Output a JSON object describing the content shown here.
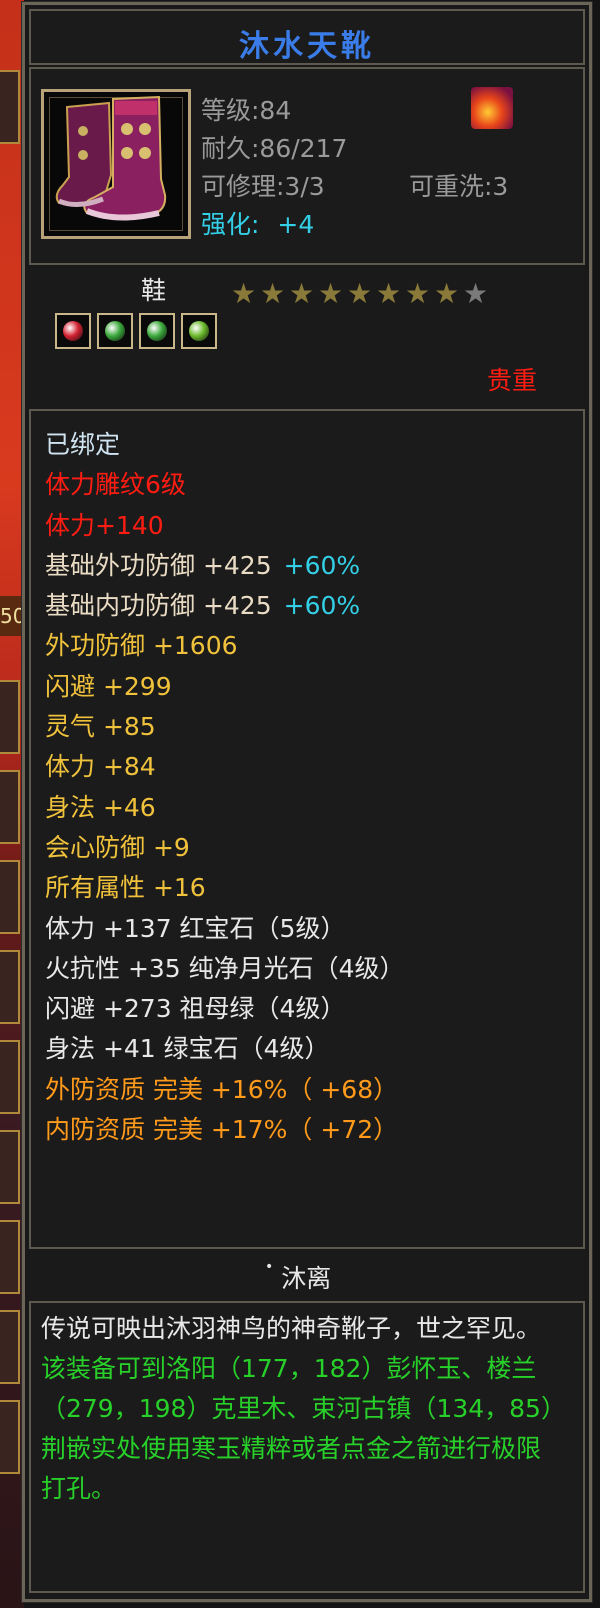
{
  "item": {
    "name": "沐水天靴",
    "level_label": "等级:84",
    "durability_label": "耐久:86/217",
    "repair_label": "可修理:3/3",
    "rewash_label": "可重洗:3",
    "enhance_label": "强化:",
    "enhance_value": "+4",
    "type": "鞋",
    "stars_total": 9,
    "stars_filled": 8,
    "rarity": "贵重",
    "gem_sockets": [
      {
        "color": "#d42030"
      },
      {
        "color": "#3aa83a"
      },
      {
        "color": "#3aa83a"
      },
      {
        "color": "#6ab82a"
      }
    ]
  },
  "stats": [
    {
      "text": "已绑定",
      "extra": "",
      "color": "light"
    },
    {
      "text": "体力雕纹6级",
      "extra": "",
      "color": "red"
    },
    {
      "text": "体力+140",
      "extra": "",
      "color": "red"
    },
    {
      "text": "基础外功防御 +425",
      "extra": "+60%",
      "color": "beige"
    },
    {
      "text": "基础内功防御 +425",
      "extra": "+60%",
      "color": "beige"
    },
    {
      "text": "外功防御 +1606",
      "extra": "",
      "color": "gold"
    },
    {
      "text": "闪避 +299",
      "extra": "",
      "color": "gold"
    },
    {
      "text": "灵气 +85",
      "extra": "",
      "color": "gold"
    },
    {
      "text": "体力 +84",
      "extra": "",
      "color": "gold"
    },
    {
      "text": "身法 +46",
      "extra": "",
      "color": "gold"
    },
    {
      "text": "会心防御 +9",
      "extra": "",
      "color": "gold"
    },
    {
      "text": "所有属性 +16",
      "extra": "",
      "color": "gold"
    },
    {
      "text": "体力 +137 红宝石（5级）",
      "extra": "",
      "color": "white"
    },
    {
      "text": "火抗性 +35 纯净月光石（4级）",
      "extra": "",
      "color": "white"
    },
    {
      "text": "闪避 +273 祖母绿（4级）",
      "extra": "",
      "color": "white"
    },
    {
      "text": "身法 +41 绿宝石（4级）",
      "extra": "",
      "color": "white"
    },
    {
      "text": "外防资质   完美 +16%（ +68）",
      "extra": "",
      "color": "orange"
    },
    {
      "text": "内防资质   完美 +17%（ +72）",
      "extra": "",
      "color": "orange"
    }
  ],
  "set_name": "沐离",
  "description": {
    "lore": "传说可映出沐羽神鸟的神奇靴子，世之罕见。",
    "hint": "该装备可到洛阳（177，182）彭怀玉、楼兰（279，198）克里木、束河古镇（134，85）荆嵌实处使用寒玉精粹或者点金之箭进行极限打孔。"
  },
  "side_number": "50"
}
